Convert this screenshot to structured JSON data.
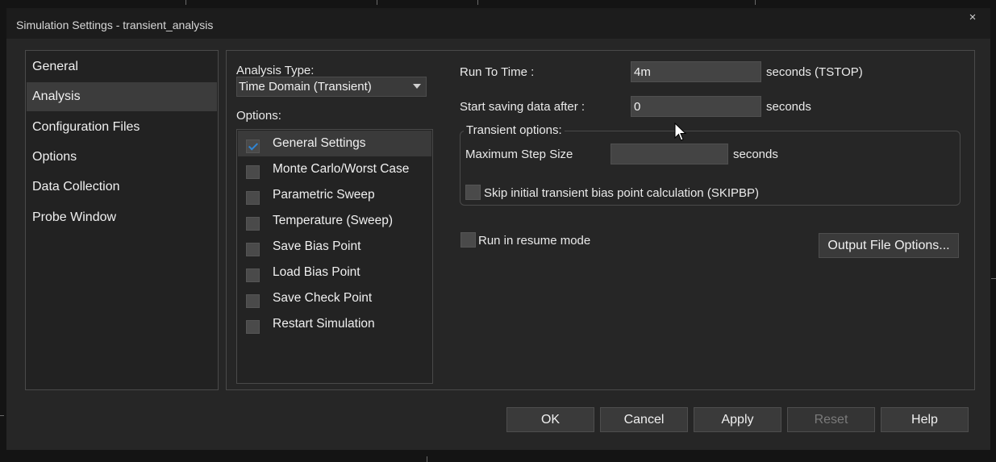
{
  "window": {
    "title": "Simulation Settings - transient_analysis",
    "close_glyph": "×"
  },
  "nav": {
    "items": [
      {
        "label": "General",
        "selected": false
      },
      {
        "label": "Analysis",
        "selected": true
      },
      {
        "label": "Configuration Files",
        "selected": false
      },
      {
        "label": "Options",
        "selected": false
      },
      {
        "label": "Data Collection",
        "selected": false
      },
      {
        "label": "Probe Window",
        "selected": false
      }
    ]
  },
  "analysis": {
    "type_label": "Analysis Type:",
    "type_value": "Time Domain (Transient)",
    "options_label": "Options:",
    "options": [
      {
        "label": "General Settings",
        "checked": true
      },
      {
        "label": "Monte Carlo/Worst Case",
        "checked": false
      },
      {
        "label": "Parametric Sweep",
        "checked": false
      },
      {
        "label": "Temperature (Sweep)",
        "checked": false
      },
      {
        "label": "Save Bias Point",
        "checked": false
      },
      {
        "label": "Load Bias Point",
        "checked": false
      },
      {
        "label": "Save Check Point",
        "checked": false
      },
      {
        "label": "Restart Simulation",
        "checked": false
      }
    ]
  },
  "settings": {
    "run_to_time_label": "Run To Time :",
    "run_to_time_value": "4m",
    "run_to_time_unit": "seconds (TSTOP)",
    "start_saving_label": "Start saving data after :",
    "start_saving_value": "0",
    "start_saving_unit": "seconds",
    "transient_group_title": "Transient options:",
    "max_step_label": "Maximum Step Size",
    "max_step_value": "",
    "max_step_unit": "seconds",
    "skip_bias_label": "Skip initial transient bias point calculation (SKIPBP)",
    "resume_mode_label": "Run in resume mode",
    "output_file_options_label": "Output File Options..."
  },
  "footer": {
    "ok_label": "OK",
    "cancel_label": "Cancel",
    "apply_label": "Apply",
    "reset_label": "Reset",
    "help_label": "Help"
  },
  "colors": {
    "check_accent": "#2f86d6",
    "background": "#262626"
  }
}
